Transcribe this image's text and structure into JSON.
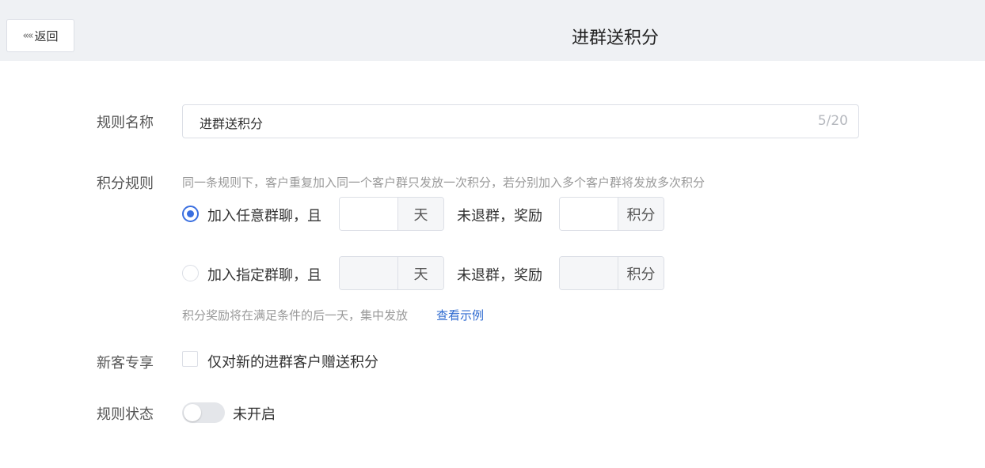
{
  "header": {
    "back_icon": "««",
    "back_label": "返回",
    "title": "进群送积分"
  },
  "form": {
    "rule_name": {
      "label": "规则名称",
      "value": "进群送积分",
      "counter": "5/20"
    },
    "points_rule": {
      "label": "积分规则",
      "hint": "同一条规则下，客户重复加入同一个客户群只发放一次积分，若分别加入多个客户群将发放多次积分",
      "options": [
        {
          "text": "加入任意群聊，且",
          "selected": true,
          "days_unit": "天",
          "mid_text": "未退群，奖励",
          "points_unit": "积分",
          "days_value": "",
          "points_value": ""
        },
        {
          "text": "加入指定群聊，且",
          "selected": false,
          "days_unit": "天",
          "mid_text": "未退群，奖励",
          "points_unit": "积分",
          "days_value": "",
          "points_value": ""
        }
      ],
      "note": "积分奖励将在满足条件的后一天，集中发放",
      "example_link": "查看示例"
    },
    "new_customer": {
      "label": "新客专享",
      "checkbox_text": "仅对新的进群客户赠送积分",
      "checked": false
    },
    "rule_status": {
      "label": "规则状态",
      "switch_text": "未开启",
      "enabled": false
    }
  },
  "colors": {
    "accent": "#3a6fe0",
    "link": "#2f6bd0",
    "header_bg": "#eff1f4"
  }
}
